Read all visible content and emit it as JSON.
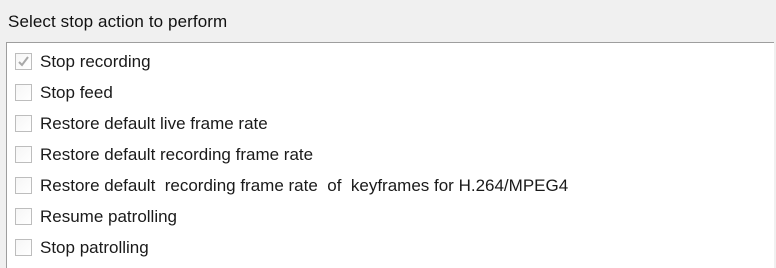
{
  "header": {
    "title": "Select stop action to perform"
  },
  "colors": {
    "check_mark": "#a8a8a8",
    "checkbox_border": "#bdbdbd",
    "list_background": "#ffffff",
    "panel_background": "#f0f0f0"
  },
  "actions": [
    {
      "label": "Stop recording",
      "checked": true
    },
    {
      "label": "Stop feed",
      "checked": false
    },
    {
      "label": "Restore default live frame rate",
      "checked": false
    },
    {
      "label": "Restore default recording frame rate",
      "checked": false
    },
    {
      "label": "Restore default  recording frame rate  of  keyframes for H.264/MPEG4",
      "checked": false
    },
    {
      "label": "Resume patrolling",
      "checked": false
    },
    {
      "label": "Stop patrolling",
      "checked": false
    }
  ]
}
